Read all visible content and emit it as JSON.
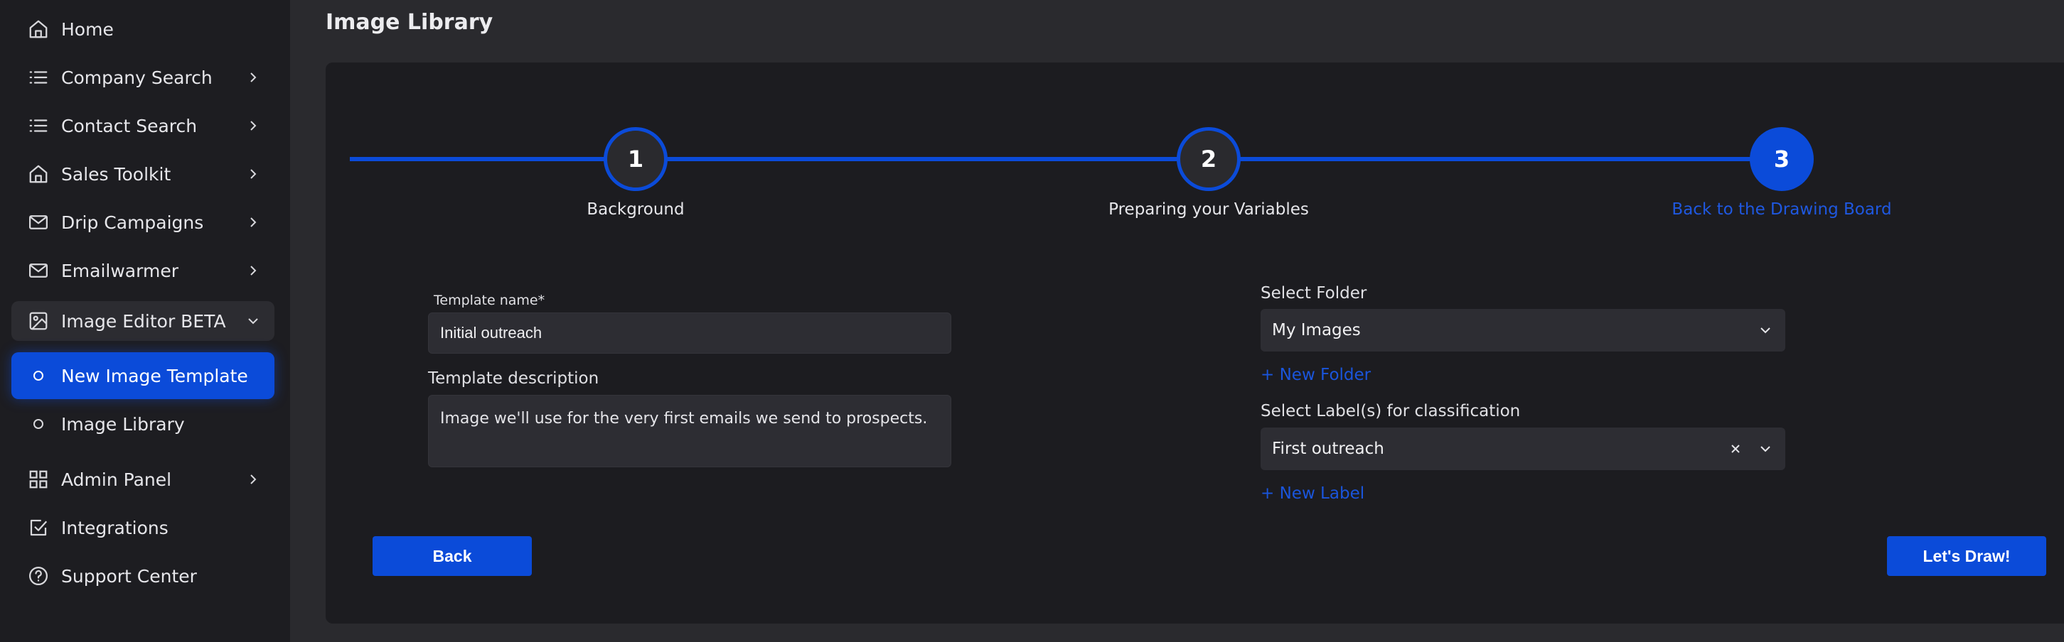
{
  "sidebar": {
    "items": [
      {
        "label": "Home",
        "icon": "home-icon"
      },
      {
        "label": "Company Search",
        "icon": "list-icon"
      },
      {
        "label": "Contact Search",
        "icon": "list-icon"
      },
      {
        "label": "Sales Toolkit",
        "icon": "home-icon"
      },
      {
        "label": "Drip Campaigns",
        "icon": "mail-icon"
      },
      {
        "label": "Emailwarmer",
        "icon": "mail-icon"
      },
      {
        "label": "Image Editor BETA",
        "icon": "image-icon"
      },
      {
        "label": "New Image Template",
        "icon": "circle-icon"
      },
      {
        "label": "Image Library",
        "icon": "circle-icon"
      },
      {
        "label": "Admin Panel",
        "icon": "grid-icon"
      },
      {
        "label": "Integrations",
        "icon": "checkbox-icon"
      },
      {
        "label": "Support Center",
        "icon": "help-icon"
      }
    ]
  },
  "header": {
    "title": "Image Library"
  },
  "stepper": {
    "steps": [
      {
        "number": "1",
        "label": "Background",
        "state": "completed"
      },
      {
        "number": "2",
        "label": "Preparing your Variables",
        "state": "completed"
      },
      {
        "number": "3",
        "label": "Back to the Drawing Board",
        "state": "current"
      }
    ]
  },
  "form": {
    "template_name_label": "Template name*",
    "template_name_value": "Initial outreach",
    "template_description_label": "Template description",
    "template_description_value": "Image we'll use for the very first emails we send to prospects.",
    "folder_label": "Select Folder",
    "folder_value": "My Images",
    "new_folder_link": "+ New Folder",
    "labels_label": "Select Label(s) for classification",
    "labels_value": "First outreach",
    "new_label_link": "+ New Label"
  },
  "actions": {
    "back_label": "Back",
    "draw_label": "Let's Draw!"
  },
  "colors": {
    "accent": "#0b4bd9",
    "link": "#1a55dc",
    "sidebar_bg": "#1d1d21",
    "panel_bg": "#1c1c20",
    "page_bg": "#2a2a2e"
  }
}
